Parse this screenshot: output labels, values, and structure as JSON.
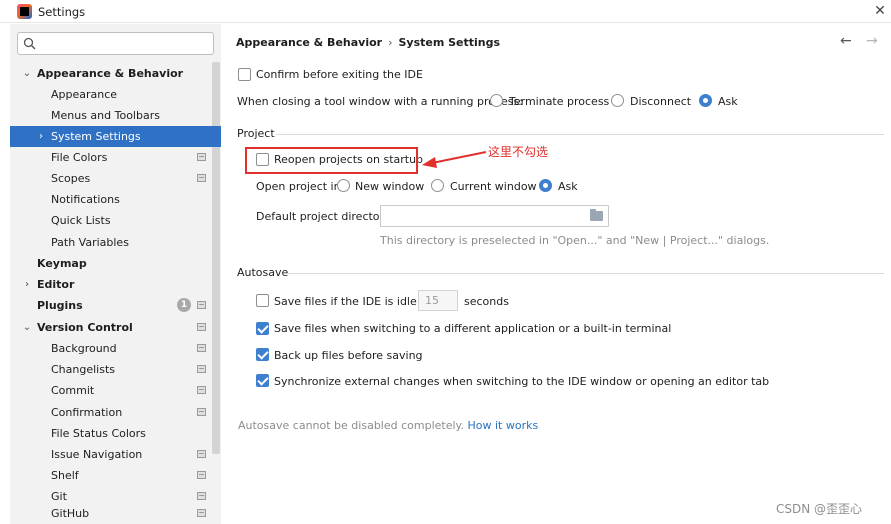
{
  "window": {
    "title": "Settings"
  },
  "sidebar": {
    "search_placeholder": "",
    "items": [
      {
        "label": "Appearance & Behavior"
      },
      {
        "label": "Appearance"
      },
      {
        "label": "Menus and Toolbars"
      },
      {
        "label": "System Settings"
      },
      {
        "label": "File Colors"
      },
      {
        "label": "Scopes"
      },
      {
        "label": "Notifications"
      },
      {
        "label": "Quick Lists"
      },
      {
        "label": "Path Variables"
      },
      {
        "label": "Keymap"
      },
      {
        "label": "Editor"
      },
      {
        "label": "Plugins",
        "badge": "1"
      },
      {
        "label": "Version Control"
      },
      {
        "label": "Background"
      },
      {
        "label": "Changelists"
      },
      {
        "label": "Commit"
      },
      {
        "label": "Confirmation"
      },
      {
        "label": "File Status Colors"
      },
      {
        "label": "Issue Navigation"
      },
      {
        "label": "Shelf"
      },
      {
        "label": "Git"
      },
      {
        "label": "GitHub"
      }
    ]
  },
  "breadcrumb": {
    "parent": "Appearance & Behavior",
    "separator": "›",
    "current": "System Settings"
  },
  "general": {
    "confirm_exit": {
      "label": "Confirm before exiting the IDE",
      "checked": false
    },
    "closing_tool_window": {
      "label": "When closing a tool window with a running process:",
      "options": [
        "Terminate process",
        "Disconnect",
        "Ask"
      ],
      "selected": "Ask"
    }
  },
  "project": {
    "section_title": "Project",
    "reopen_on_startup": {
      "label": "Reopen projects on startup",
      "checked": false
    },
    "open_project_in": {
      "label": "Open project in",
      "options": [
        "New window",
        "Current window",
        "Ask"
      ],
      "selected": "Ask"
    },
    "default_directory": {
      "label": "Default project directory:",
      "value": "",
      "hint": "This directory is preselected in \"Open...\" and \"New | Project...\" dialogs."
    }
  },
  "autosave": {
    "section_title": "Autosave",
    "idle": {
      "label": "Save files if the IDE is idle for",
      "value": "15",
      "unit": "seconds",
      "checked": false
    },
    "switching_app": {
      "label": "Save files when switching to a different application or a built-in terminal",
      "checked": true
    },
    "backup": {
      "label": "Back up files before saving",
      "checked": true
    },
    "sync_external": {
      "label": "Synchronize external changes when switching to the IDE window or opening an editor tab",
      "checked": true
    },
    "note": "Autosave cannot be disabled completely.",
    "note_link": "How it works"
  },
  "annotation": {
    "text": "这里不勾选"
  },
  "watermark": "CSDN @歪歪心",
  "colors": {
    "accent": "#2f71c5",
    "annotation": "#e0312c",
    "sidebar_bg": "#f2f2f2"
  }
}
